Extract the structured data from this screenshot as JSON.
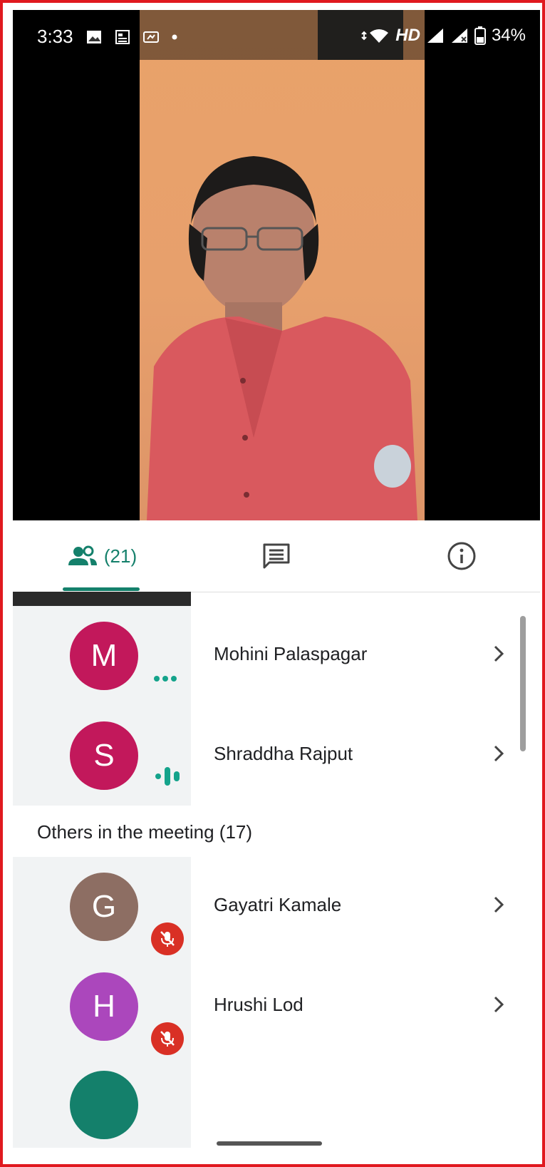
{
  "status_bar": {
    "time": "3:33",
    "network": "HD",
    "battery": "34%"
  },
  "tabs": {
    "people_count": "(21)",
    "people_icon": "people-icon",
    "chat_icon": "chat-icon",
    "info_icon": "info-icon"
  },
  "participants": [
    {
      "initial": "M",
      "name": "Mohini Palaspagar",
      "avatar_color": "#c2185b",
      "status": "connecting"
    },
    {
      "initial": "S",
      "name": "Shraddha Rajput",
      "avatar_color": "#c2185b",
      "status": "speaking"
    }
  ],
  "others_section": {
    "title": "Others in the meeting (17)",
    "participants": [
      {
        "initial": "G",
        "name": "Gayatri Kamale",
        "avatar_color": "#8d6e63",
        "status": "muted"
      },
      {
        "initial": "H",
        "name": "Hrushi Lod",
        "avatar_color": "#ab47bc",
        "status": "muted"
      }
    ]
  },
  "colors": {
    "accent": "#14806b",
    "mute": "#d93025",
    "frame": "#e0191f"
  }
}
